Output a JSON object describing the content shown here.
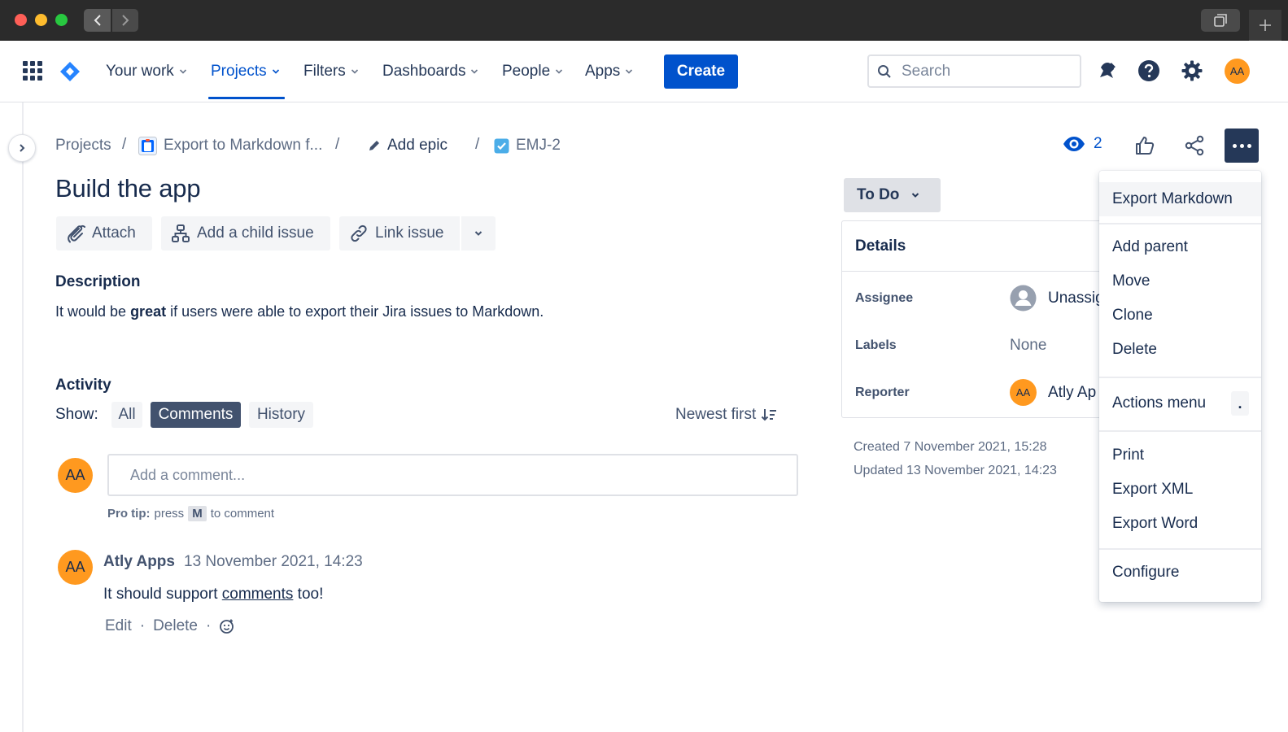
{
  "nav": {
    "items": [
      {
        "label": "Your work"
      },
      {
        "label": "Projects"
      },
      {
        "label": "Filters"
      },
      {
        "label": "Dashboards"
      },
      {
        "label": "People"
      },
      {
        "label": "Apps"
      }
    ],
    "active_item": "Projects",
    "create_label": "Create",
    "search_placeholder": "Search",
    "user_initials": "AA"
  },
  "breadcrumbs": {
    "projects": "Projects",
    "project_name": "Export to Markdown f...",
    "epic": "Add epic",
    "issue_key": "EMJ-2",
    "separator": "/"
  },
  "issue": {
    "title": "Build the app",
    "actions": {
      "attach": "Attach",
      "child": "Add a child issue",
      "link": "Link issue"
    },
    "description_heading": "Description",
    "description": {
      "before": "It would be ",
      "bold": "great",
      "after": " if users were able to export their Jira issues to Markdown."
    }
  },
  "activity": {
    "heading": "Activity",
    "show_label": "Show:",
    "filters": [
      "All",
      "Comments",
      "History"
    ],
    "selected_filter": "Comments",
    "sort_label": "Newest first",
    "comment_placeholder": "Add a comment...",
    "pro_tip": {
      "label": "Pro tip:",
      "before": "press",
      "key": "M",
      "after": "to comment"
    },
    "comments": [
      {
        "author": "Atly Apps",
        "initials": "AA",
        "time": "13 November 2021, 14:23",
        "body_before": "It should support ",
        "body_link": "comments",
        "body_after": " too!",
        "actions": [
          "Edit",
          "Delete"
        ],
        "dot": "·"
      }
    ]
  },
  "right": {
    "watchers": "2",
    "status": "To Do",
    "details_heading": "Details",
    "fields": {
      "assignee_label": "Assignee",
      "assignee_value": "Unassig",
      "labels_label": "Labels",
      "labels_value": "None",
      "reporter_label": "Reporter",
      "reporter_initials": "AA",
      "reporter_value": "Atly Ap"
    },
    "created": "Created 7 November 2021, 15:28",
    "updated": "Updated 13 November 2021, 14:23"
  },
  "menu": {
    "items": [
      "Export Markdown",
      "Add parent",
      "Move",
      "Clone",
      "Delete",
      "Actions menu",
      "Print",
      "Export XML",
      "Export Word",
      "Configure"
    ],
    "actions_badge": "."
  },
  "colors": {
    "brand_blue": "#0052cc",
    "avatar_orange": "#ff991f",
    "text_dark": "#172b4d"
  }
}
